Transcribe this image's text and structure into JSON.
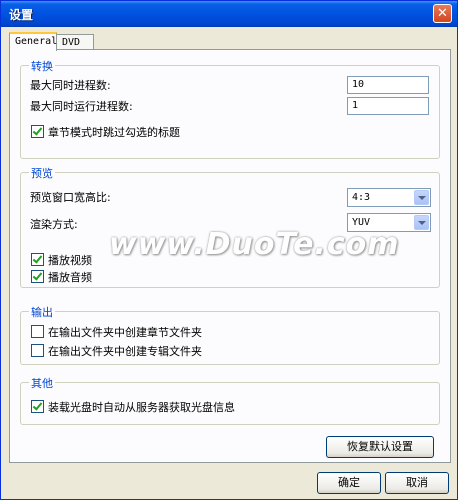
{
  "window": {
    "title": "设置",
    "close_label": "✕"
  },
  "tabs": [
    {
      "label": "General",
      "active": true
    },
    {
      "label": "DVD",
      "active": false
    }
  ],
  "groups": {
    "convert": {
      "title": "转换",
      "max_processes_label": "最大同时进程数:",
      "max_processes_value": "10",
      "max_running_label": "最大同时运行进程数:",
      "max_running_value": "1",
      "skip_checked_label": "章节模式时跳过勾选的标题",
      "skip_checked": true
    },
    "preview": {
      "title": "预览",
      "aspect_label": "预览窗口宽高比:",
      "aspect_value": "4:3",
      "render_label": "渲染方式:",
      "render_value": "YUV",
      "play_video_label": "播放视频",
      "play_video": true,
      "play_audio_label": "播放音频",
      "play_audio": true
    },
    "output": {
      "title": "输出",
      "chapter_folder_label": "在输出文件夹中创建章节文件夹",
      "chapter_folder": false,
      "album_folder_label": "在输出文件夹中创建专辑文件夹",
      "album_folder": false
    },
    "other": {
      "title": "其他",
      "auto_disc_info_label": "装载光盘时自动从服务器获取光盘信息",
      "auto_disc_info": true
    }
  },
  "buttons": {
    "restore_defaults": "恢复默认设置",
    "ok": "确定",
    "cancel": "取消"
  },
  "watermark": "www.DuoTe.com",
  "colors": {
    "titlebar": "#0052e0",
    "group_title": "#0046d5",
    "check": "#21a121"
  }
}
